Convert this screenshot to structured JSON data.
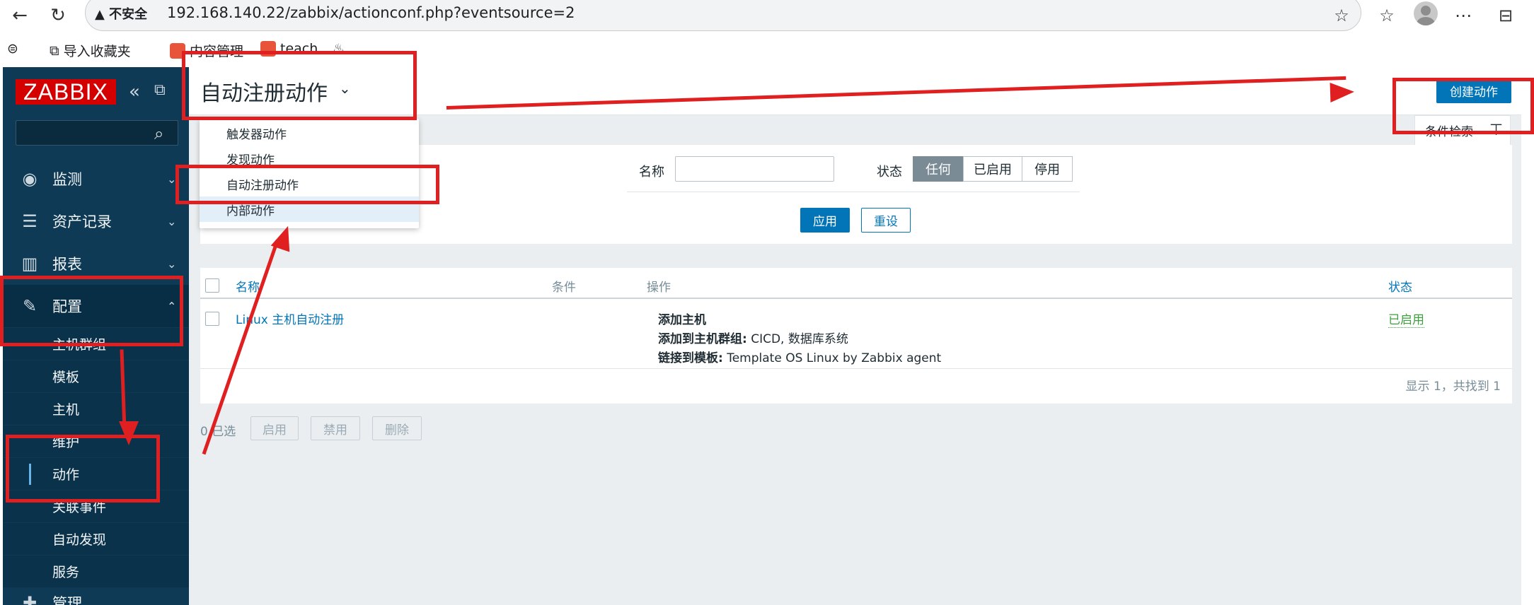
{
  "browser": {
    "security_label": "不安全",
    "url": "192.168.140.22/zabbix/actionconf.php?eventsource=2",
    "bookmarks": [
      "导入收藏夹",
      "内容管理",
      "teach"
    ]
  },
  "sidebar": {
    "logo": "ZABBIX",
    "search_placeholder": "",
    "menu": [
      {
        "label": "监测",
        "icon": "eye-icon"
      },
      {
        "label": "资产记录",
        "icon": "list-icon"
      },
      {
        "label": "报表",
        "icon": "bar-chart-icon"
      },
      {
        "label": "配置",
        "icon": "wrench-icon"
      }
    ],
    "submenu": [
      "主机群组",
      "模板",
      "主机",
      "维护",
      "动作",
      "关联事件",
      "自动发现",
      "服务"
    ],
    "next_menu": "管理"
  },
  "header": {
    "title": "自动注册动作",
    "create_button": "创建动作"
  },
  "dropdown": {
    "items": [
      "触发器动作",
      "发现动作",
      "自动注册动作",
      "内部动作"
    ]
  },
  "filter": {
    "tab_label": "条件检索",
    "name_label": "名称",
    "name_value": "",
    "status_label": "状态",
    "status_options": [
      "任何",
      "已启用",
      "停用"
    ],
    "apply": "应用",
    "reset": "重设"
  },
  "table": {
    "columns": [
      "名称",
      "条件",
      "操作",
      "状态"
    ],
    "rows": [
      {
        "name": "Linux 主机自动注册",
        "conditions": "",
        "op1": "添加主机",
        "op2_label": "添加到主机群组:",
        "op2_value": " CICD, 数据库系统",
        "op3_label": "链接到模板:",
        "op3_value": " Template OS Linux by Zabbix agent",
        "status": "已启用"
      }
    ],
    "paging": "显示 1，共找到 1"
  },
  "bulk": {
    "selected": "0 已选",
    "buttons": [
      "启用",
      "禁用",
      "删除"
    ]
  },
  "colors": {
    "sidebar": "#0e3a55",
    "accent": "#0275b8",
    "annotation": "#e02020",
    "enabled": "#3fa03f"
  }
}
